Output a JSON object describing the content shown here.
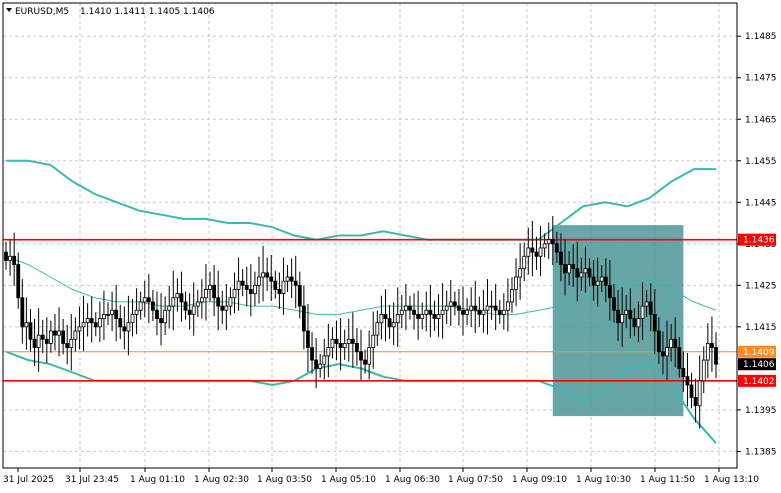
{
  "header": {
    "menu_icon": "triangle-down-icon",
    "symbol": "EURUSD,M5",
    "ohlc": "1.1410 1.1411 1.1405 1.1406"
  },
  "colors": {
    "background": "#ffffff",
    "candle": "#000000",
    "band": "#3cb8b2",
    "resistance_line": "#ff0000",
    "bid_line": "#ff8c1a",
    "box": "#4b9696",
    "label_red": "#ff0000",
    "label_orange": "#ff8c1a",
    "label_dark": "#000000"
  },
  "chart_data": {
    "type": "candlestick",
    "symbol": "EURUSD",
    "timeframe": "M5",
    "y_ticks": [
      "1.1485",
      "1.1475",
      "1.1465",
      "1.1455",
      "1.1445",
      "1.1435",
      "1.1425",
      "1.1415",
      "1.1395",
      "1.1385"
    ],
    "y_range": [
      1.1381,
      1.1493
    ],
    "x_ticks": [
      "31 Jul 2025",
      "31 Jul 23:45",
      "1 Aug 01:10",
      "1 Aug 02:30",
      "1 Aug 03:50",
      "1 Aug 05:10",
      "1 Aug 06:30",
      "1 Aug 07:50",
      "1 Aug 09:10",
      "1 Aug 10:30",
      "1 Aug 11:50",
      "1 Aug 13:10"
    ],
    "period_separator_after_label": "31 Jul 23:45",
    "grid": true,
    "price_labels": [
      {
        "text": "1.1436",
        "value": 1.1436,
        "style": "red"
      },
      {
        "text": "1.1409",
        "value": 1.1409,
        "style": "orange"
      },
      {
        "text": "1.1406",
        "value": 1.1406,
        "style": "dark"
      },
      {
        "text": "1.1402",
        "value": 1.1402,
        "style": "red"
      }
    ],
    "horizontal_lines": [
      {
        "value": 1.1436,
        "style": "red"
      },
      {
        "value": 1.1402,
        "style": "red"
      },
      {
        "value": 1.1409,
        "style": "orange"
      }
    ],
    "highlight_box": {
      "from_bar": 134,
      "to_bar": 166,
      "top": 1.14395,
      "bottom": 1.13935
    },
    "bollinger": {
      "upper": [
        1.1455,
        1.1455,
        1.1454,
        1.145,
        1.1447,
        1.1445,
        1.1443,
        1.1442,
        1.1441,
        1.1441,
        1.144,
        1.144,
        1.1439,
        1.1437,
        1.1436,
        1.1437,
        1.1437,
        1.1438,
        1.1437,
        1.1436,
        1.1436,
        1.1436,
        1.1436,
        1.1436,
        1.1436,
        1.144,
        1.1444,
        1.1445,
        1.1444,
        1.1446,
        1.145,
        1.1453,
        1.1453
      ],
      "middle": [
        1.1432,
        1.143,
        1.1427,
        1.1424,
        1.1422,
        1.1421,
        1.1421,
        1.142,
        1.142,
        1.1421,
        1.1421,
        1.142,
        1.142,
        1.1419,
        1.1418,
        1.1418,
        1.1419,
        1.142,
        1.142,
        1.142,
        1.142,
        1.1419,
        1.1418,
        1.1418,
        1.1419,
        1.142,
        1.1422,
        1.1424,
        1.1425,
        1.1426,
        1.1424,
        1.1421,
        1.1419
      ],
      "lower": [
        1.1409,
        1.1407,
        1.1406,
        1.1404,
        1.1402,
        1.1402,
        1.1402,
        1.1402,
        1.1402,
        1.1402,
        1.1402,
        1.1402,
        1.1401,
        1.1402,
        1.1405,
        1.1406,
        1.1405,
        1.1403,
        1.1402,
        1.1402,
        1.1402,
        1.1402,
        1.1402,
        1.1402,
        1.1402,
        1.14,
        1.1397,
        1.14,
        1.1405,
        1.1406,
        1.1401,
        1.1393,
        1.1387
      ]
    },
    "close": [
      1.1431,
      1.1432,
      1.143,
      1.1422,
      1.1415,
      1.1416,
      1.1412,
      1.141,
      1.1413,
      1.1412,
      1.1411,
      1.1414,
      1.1413,
      1.1414,
      1.1411,
      1.141,
      1.1412,
      1.1414,
      1.1415,
      1.1416,
      1.1417,
      1.1416,
      1.1415,
      1.1417,
      1.1418,
      1.1418,
      1.1419,
      1.1417,
      1.1415,
      1.1414,
      1.1416,
      1.1418,
      1.1419,
      1.1421,
      1.1422,
      1.1421,
      1.1419,
      1.1417,
      1.1416,
      1.1419,
      1.142,
      1.1422,
      1.1423,
      1.1421,
      1.1419,
      1.1418,
      1.142,
      1.1421,
      1.1422,
      1.1424,
      1.1425,
      1.1422,
      1.142,
      1.1419,
      1.142,
      1.1422,
      1.1424,
      1.1426,
      1.1425,
      1.1424,
      1.1423,
      1.1425,
      1.1427,
      1.1428,
      1.1427,
      1.1426,
      1.1424,
      1.1423,
      1.1426,
      1.1427,
      1.1426,
      1.1425,
      1.142,
      1.1414,
      1.141,
      1.1407,
      1.1405,
      1.1406,
      1.1408,
      1.141,
      1.1412,
      1.1411,
      1.141,
      1.1411,
      1.1412,
      1.1411,
      1.1409,
      1.1407,
      1.1406,
      1.141,
      1.1413,
      1.1416,
      1.1418,
      1.1417,
      1.1415,
      1.1416,
      1.1418,
      1.1419,
      1.142,
      1.1419,
      1.1418,
      1.1417,
      1.1418,
      1.1419,
      1.1418,
      1.1417,
      1.1418,
      1.1419,
      1.142,
      1.1421,
      1.142,
      1.1419,
      1.1418,
      1.1419,
      1.142,
      1.1419,
      1.1418,
      1.1419,
      1.142,
      1.142,
      1.1419,
      1.1418,
      1.1419,
      1.1421,
      1.1424,
      1.1427,
      1.1429,
      1.1432,
      1.1434,
      1.1433,
      1.1432,
      1.1434,
      1.1435,
      1.1436,
      1.1435,
      1.1433,
      1.143,
      1.1428,
      1.143,
      1.1429,
      1.1427,
      1.1428,
      1.1429,
      1.1427,
      1.1425,
      1.1426,
      1.1427,
      1.1425,
      1.1422,
      1.1419,
      1.1416,
      1.1418,
      1.1419,
      1.1417,
      1.1415,
      1.1417,
      1.142,
      1.1421,
      1.1418,
      1.1414,
      1.1409,
      1.1408,
      1.141,
      1.1412,
      1.141,
      1.1405,
      1.1403,
      1.1401,
      1.1398,
      1.1396,
      1.1402,
      1.1407,
      1.1411,
      1.141,
      1.1406
    ]
  }
}
